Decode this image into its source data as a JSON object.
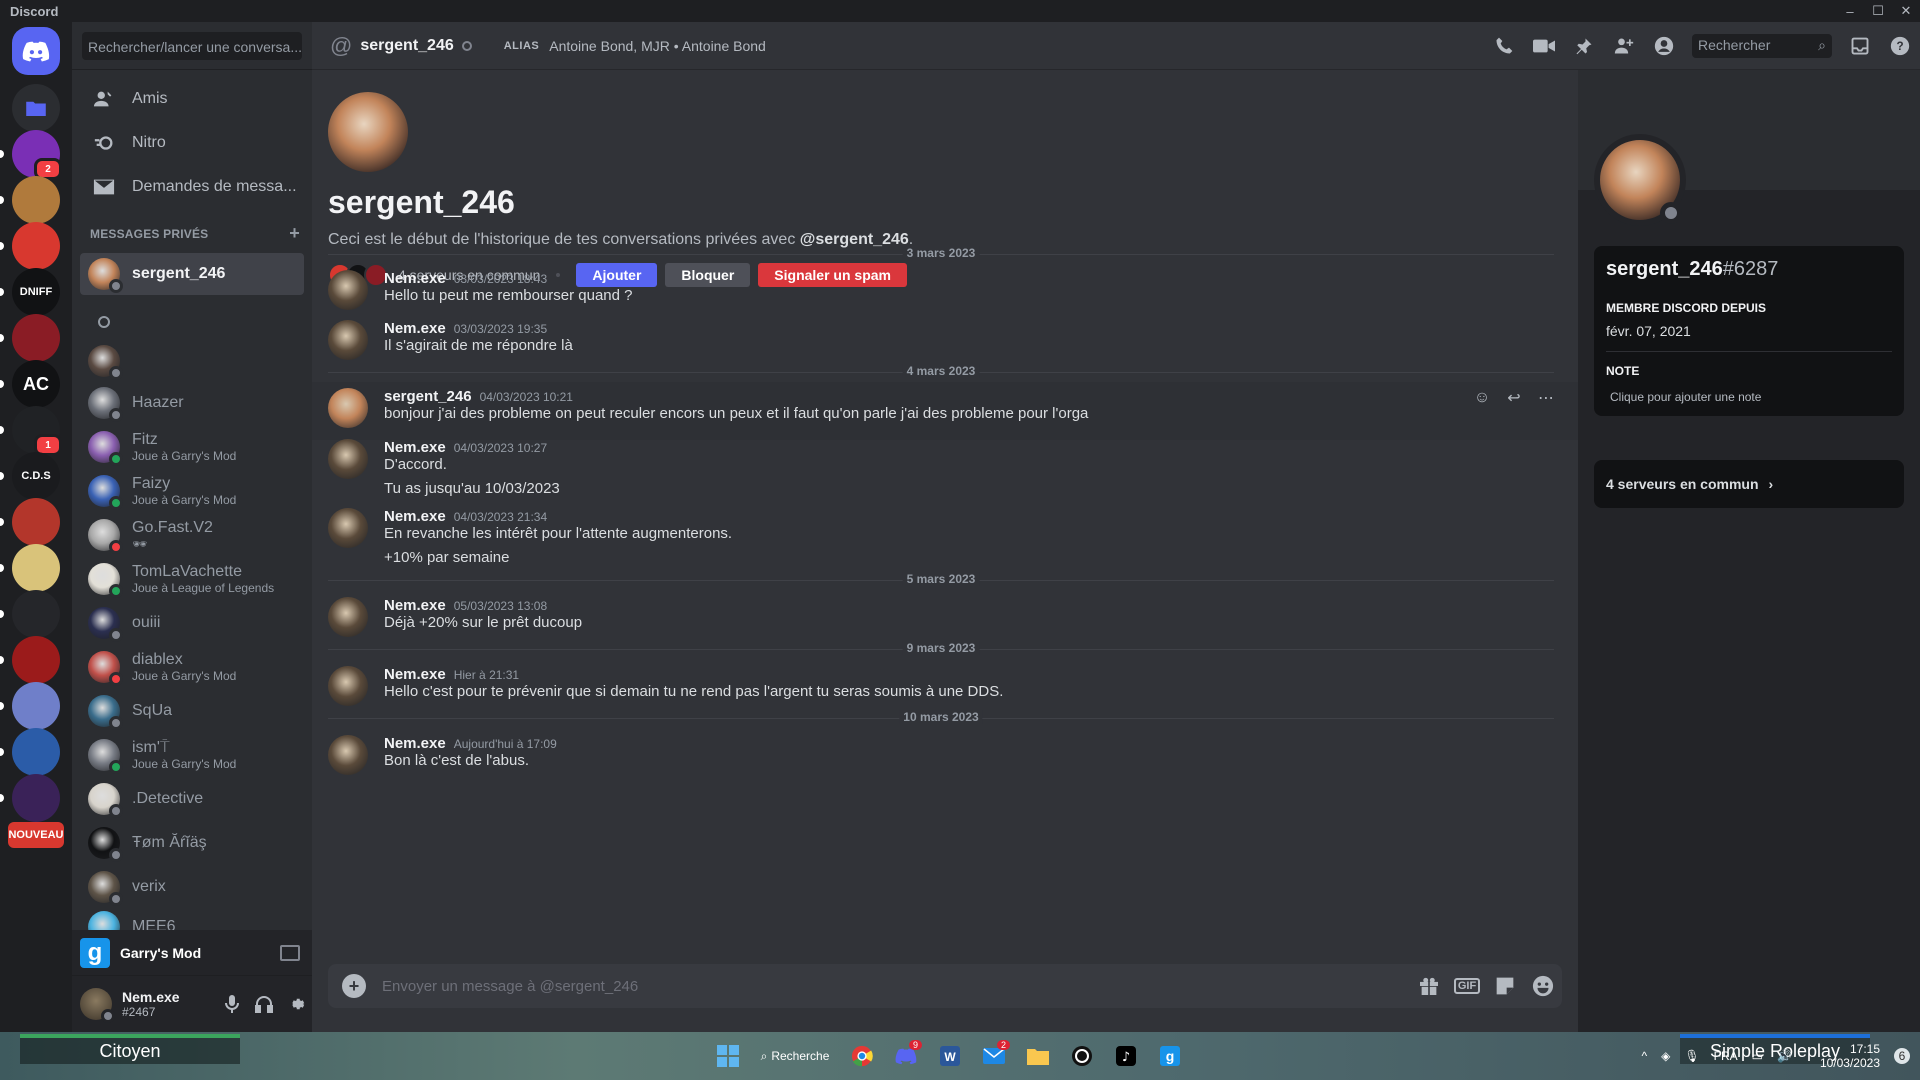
{
  "window": {
    "app_title": "Discord",
    "controls": [
      "–",
      "☐",
      "✕"
    ]
  },
  "servers": [
    {
      "label": "",
      "color": "#5865f2",
      "icon": "discord-logo-icon",
      "badge": ""
    },
    {
      "label": "",
      "color": "#2b2d31",
      "icon": "folder-icon",
      "badge": ""
    },
    {
      "label": "",
      "color": "#7a2fb5",
      "icon": "server-icon",
      "badge": "2"
    },
    {
      "label": "",
      "color": "#b07a3c",
      "icon": "server-icon",
      "badge": ""
    },
    {
      "label": "",
      "color": "#d8382f",
      "icon": "server-icon",
      "badge": ""
    },
    {
      "label": "DNIFF",
      "color": "#111214",
      "icon": "server-icon",
      "badge": ""
    },
    {
      "label": "",
      "color": "#8a1c25",
      "icon": "server-icon",
      "badge": ""
    },
    {
      "label": "AC",
      "color": "#111214",
      "icon": "server-icon",
      "badge": ""
    },
    {
      "label": "",
      "color": "#202225",
      "icon": "server-icon",
      "badge": "1"
    },
    {
      "label": "C.D.S",
      "color": "#1a1b1e",
      "icon": "server-icon",
      "badge": ""
    },
    {
      "label": "",
      "color": "#b3362b",
      "icon": "server-icon",
      "badge": ""
    },
    {
      "label": "",
      "color": "#d9c37a",
      "icon": "server-icon",
      "badge": ""
    },
    {
      "label": "",
      "color": "#25262a",
      "icon": "server-icon",
      "badge": ""
    },
    {
      "label": "",
      "color": "#9b1b1b",
      "icon": "server-icon",
      "badge": ""
    },
    {
      "label": "",
      "color": "#6f7fc9",
      "icon": "server-icon",
      "badge": ""
    },
    {
      "label": "",
      "color": "#2b5ca8",
      "icon": "server-icon",
      "badge": ""
    },
    {
      "label": "",
      "color": "#3a2258",
      "icon": "server-icon",
      "badge": ""
    },
    {
      "label": "NOUVEAU",
      "color": "#d8382f",
      "icon": "server-icon",
      "badge": ""
    }
  ],
  "dm_sidebar": {
    "search_placeholder": "Rechercher/lancer une conversa...",
    "nav": [
      {
        "label": "Amis",
        "icon": "friends-icon"
      },
      {
        "label": "Nitro",
        "icon": "nitro-icon"
      },
      {
        "label": "Demandes de messa...",
        "icon": "envelope-icon"
      }
    ],
    "section_title": "MESSAGES PRIVÉS",
    "add_symbol": "+",
    "dms": [
      {
        "name": "sergent_246",
        "sub": "",
        "status": "offline",
        "avatar": "#c2845a",
        "active": true
      },
      {
        "name": "",
        "sub": "",
        "status": "offline",
        "avatar": "",
        "active": false
      },
      {
        "name": "",
        "sub": "",
        "status": "offline",
        "avatar": "#5a4a42",
        "active": false
      },
      {
        "name": "Haazer",
        "sub": "",
        "status": "offline",
        "avatar": "#6b6f78",
        "active": false
      },
      {
        "name": "Fitz",
        "sub": "Joue à Garry's Mod",
        "status": "online",
        "avatar": "#8a5fb0",
        "active": false
      },
      {
        "name": "Faizy",
        "sub": "Joue à Garry's Mod",
        "status": "online",
        "avatar": "#3a62b5",
        "active": false
      },
      {
        "name": "Go.Fast.V2",
        "sub": "🕶",
        "status": "dnd",
        "avatar": "#a8a8a8",
        "active": false
      },
      {
        "name": "TomLaVachette",
        "sub": "Joue à League of Legends",
        "status": "online",
        "avatar": "#e3e0d8",
        "active": false
      },
      {
        "name": "ouiii",
        "sub": "",
        "status": "offline",
        "avatar": "#2b2f50",
        "active": false
      },
      {
        "name": "diablex",
        "sub": "Joue à Garry's Mod",
        "status": "dnd",
        "avatar": "#c0504a",
        "active": false
      },
      {
        "name": "SqUa",
        "sub": "",
        "status": "offline",
        "avatar": "#3a6d8c",
        "active": false
      },
      {
        "name": "ism'⍑",
        "sub": "Joue à Garry's Mod",
        "status": "online",
        "avatar": "#777b84",
        "active": false
      },
      {
        "name": ".Detective",
        "sub": "",
        "status": "offline",
        "avatar": "#d8d4cc",
        "active": false
      },
      {
        "name": "Ŧøm Ăŕĭäş",
        "sub": "",
        "status": "offline",
        "avatar": "#111214",
        "active": false
      },
      {
        "name": "verix",
        "sub": "",
        "status": "offline",
        "avatar": "#5e5448",
        "active": false
      },
      {
        "name": "MEE6",
        "sub": "",
        "status": "offline",
        "avatar": "#4bb3e0",
        "active": false
      }
    ],
    "activity": {
      "letter": "g",
      "title": "Garry's Mod"
    },
    "user": {
      "name": "Nem.exe",
      "tag": "#2467"
    }
  },
  "header": {
    "username": "sergent_246",
    "alias_label": "ALIAS",
    "alias_value": "Antoine Bond, MJR • Antoine Bond",
    "search_placeholder": "Rechercher"
  },
  "intro": {
    "title": "sergent_246",
    "description_prefix": "Ceci est le début de l'historique de tes conversations privées avec ",
    "description_mention": "@sergent_246",
    "description_suffix": ".",
    "mutual_text": "4 serveurs en commun",
    "buttons": {
      "add": "Ajouter",
      "block": "Bloquer",
      "spam": "Signaler un spam"
    }
  },
  "dividers": [
    "3 mars 2023",
    "4 mars 2023",
    "5 mars 2023",
    "9 mars 2023",
    "10 mars 2023"
  ],
  "messages": [
    {
      "author": "Nem.exe",
      "time": "03/03/2023 18:43",
      "lines": [
        "Hello tu peut me rembourser quand ?"
      ],
      "avatar": "#5a4a3a"
    },
    {
      "author": "Nem.exe",
      "time": "03/03/2023 19:35",
      "lines": [
        "Il s'agirait de me répondre là"
      ],
      "avatar": "#5a4a3a"
    },
    {
      "author": "sergent_246",
      "time": "04/03/2023 10:21",
      "lines": [
        "bonjour j'ai des probleme on peut reculer encors un peux et il faut qu'on parle j'ai des probleme pour l'orga"
      ],
      "avatar": "#c2845a"
    },
    {
      "author": "Nem.exe",
      "time": "04/03/2023 10:27",
      "lines": [
        "D'accord.",
        "Tu as jusqu'au 10/03/2023"
      ],
      "avatar": "#5a4a3a"
    },
    {
      "author": "Nem.exe",
      "time": "04/03/2023 21:34",
      "lines": [
        "En revanche les intérêt pour l'attente augmenterons.",
        "+10% par semaine"
      ],
      "avatar": "#5a4a3a"
    },
    {
      "author": "Nem.exe",
      "time": "05/03/2023 13:08",
      "lines": [
        "Déjà +20% sur le prêt ducoup"
      ],
      "avatar": "#5a4a3a"
    },
    {
      "author": "Nem.exe",
      "time": "Hier à 21:31",
      "lines": [
        "Hello c'est pour te prévenir que si demain tu ne rend pas l'argent tu seras soumis à une DDS."
      ],
      "avatar": "#5a4a3a"
    },
    {
      "author": "Nem.exe",
      "time": "Aujourd'hui à 17:09",
      "lines": [
        "Bon là c'est de l'abus."
      ],
      "avatar": "#5a4a3a"
    }
  ],
  "composer": {
    "placeholder": "Envoyer un message à @sergent_246",
    "gif_label": "GIF"
  },
  "profile": {
    "name": "sergent_246",
    "discriminator": "#6287",
    "member_since_label": "MEMBRE DISCORD DEPUIS",
    "member_since_value": "févr. 07, 2021",
    "note_label": "NOTE",
    "note_placeholder": "Clique pour ajouter une note",
    "mutual_servers": "4 serveurs en commun"
  },
  "taskbar": {
    "rank_text": "Citoyen",
    "search_label": "Recherche",
    "game_text": "Simple Roleplay",
    "lang": "FRA",
    "time": "17:15",
    "date": "10/03/2023",
    "notif_count": "6",
    "discord_badge": "9",
    "mail_badge": "2"
  }
}
